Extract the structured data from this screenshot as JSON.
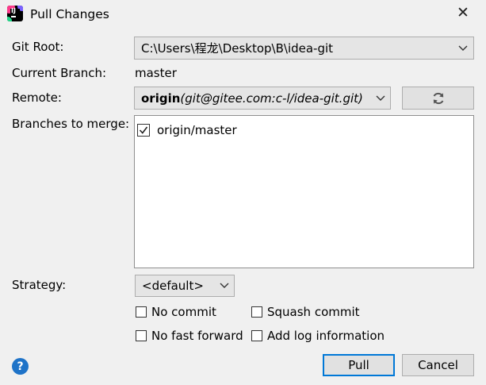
{
  "window": {
    "title": "Pull Changes",
    "close_glyph": "✕",
    "icon": "intellij-idea-icon"
  },
  "form": {
    "git_root": {
      "label": "Git Root:",
      "value": "C:\\Users\\程龙\\Desktop\\B\\idea-git"
    },
    "current_branch": {
      "label": "Current Branch:",
      "value": "master"
    },
    "remote": {
      "label": "Remote:",
      "name": "origin",
      "url": "(git@gitee.com:c-l/idea-git.git)"
    },
    "branches": {
      "label": "Branches to merge:",
      "items": [
        {
          "label": "origin/master",
          "checked": true
        }
      ]
    },
    "strategy": {
      "label": "Strategy:",
      "value": "<default>"
    }
  },
  "options": {
    "no_commit": {
      "label": "No commit",
      "checked": false
    },
    "squash_commit": {
      "label": "Squash commit",
      "checked": false
    },
    "no_fast_forward": {
      "label": "No fast forward",
      "checked": false
    },
    "add_log_information": {
      "label": "Add log information",
      "checked": false
    }
  },
  "buttons": {
    "pull": "Pull",
    "cancel": "Cancel",
    "help": "?"
  },
  "colors": {
    "background": "#f0f0f0",
    "default_button_border": "#0078d7",
    "help_icon": "#1e73c8"
  }
}
